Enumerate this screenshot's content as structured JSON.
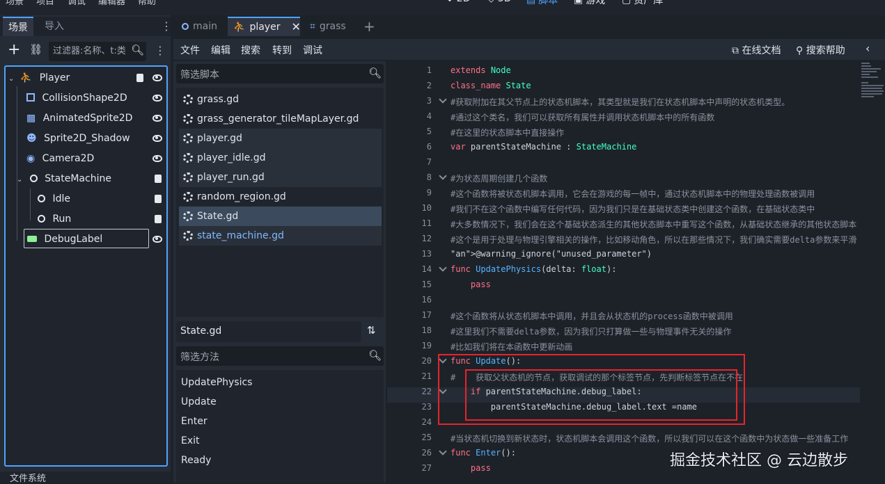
{
  "menubar": {
    "items": [
      "场景",
      "项目",
      "调试",
      "编辑器",
      "帮助"
    ],
    "workspaces": [
      {
        "label": "2D",
        "icon": "2d-icon"
      },
      {
        "label": "3D",
        "icon": "3d-icon"
      },
      {
        "label": "脚本",
        "icon": "script-icon",
        "active": true
      },
      {
        "label": "游戏",
        "icon": "game-icon"
      },
      {
        "label": "资产库",
        "icon": "assetlib-icon"
      }
    ]
  },
  "scene_dock": {
    "tabs": [
      "场景",
      "导入"
    ],
    "filter_placeholder": "过滤器:名称、t:类",
    "nodes": [
      {
        "name": "Player",
        "icon": "player-icon"
      },
      {
        "name": "CollisionShape2D",
        "icon": "collision-shape-icon"
      },
      {
        "name": "AnimatedSprite2D",
        "icon": "animated-sprite-icon"
      },
      {
        "name": "Sprite2D_Shadow",
        "icon": "sprite-icon"
      },
      {
        "name": "Camera2D",
        "icon": "camera-icon"
      },
      {
        "name": "StateMachine",
        "icon": "node-icon"
      },
      {
        "name": "Idle",
        "icon": "node-icon"
      },
      {
        "name": "Run",
        "icon": "node-icon"
      },
      {
        "name": "DebugLabel",
        "icon": "label-icon"
      }
    ],
    "bottom_tab": "文件系统"
  },
  "editor_tabs": [
    {
      "label": "main",
      "icon": "node-icon"
    },
    {
      "label": "player",
      "icon": "player-icon",
      "active": true
    },
    {
      "label": "grass",
      "icon": "grass-icon"
    }
  ],
  "script_menu": {
    "items": [
      "文件",
      "编辑",
      "搜索",
      "转到",
      "调试"
    ],
    "online_docs": "在线文档",
    "search_help": "搜索帮助"
  },
  "script_list": {
    "filter_placeholder": "筛选脚本",
    "items": [
      "grass.gd",
      "grass_generator_tileMapLayer.gd",
      "player.gd",
      "player_idle.gd",
      "player_run.gd",
      "random_region.gd",
      "State.gd",
      "state_machine.gd"
    ],
    "selected": "State.gd",
    "current_file": "State.gd"
  },
  "methods": {
    "filter_placeholder": "筛选方法",
    "items": [
      "UpdatePhysics",
      "Update",
      "Enter",
      "Exit",
      "Ready"
    ]
  },
  "code_lines": [
    "extends Node",
    "class_name State",
    "#获取附加在其父节点上的状态机脚本，其类型就是我们在状态机脚本中声明的状态机类型。",
    "#通过这个类名，我们可以获取所有属性并调用状态机脚本中的所有函数",
    "#在这里的状态脚本中直接操作",
    "var parentStateMachine : StateMachine",
    "",
    "#为状态周期创建几个函数",
    "#这个函数将被状态机脚本调用，它会在游戏的每一帧中，通过状态机脚本中的物理处理函数被调用",
    "#我们不在这个函数中编写任何代码，因为我们只是在基础状态类中创建这个函数，在基础状态类中",
    "#大多数情况下，我们会在这个基础状态派生的其他状态脚本中重写这个函数，从基础状态继承的其他状态脚本",
    "#这个是用于处理与物理引擎相关的操作，比如移动角色，所以在那些情况下，我们确实需要delta参数来平滑",
    "@warning_ignore(\"unused_parameter\")",
    "func UpdatePhysics(delta: float):",
    "    pass",
    "",
    "#这个函数将从状态机脚本中调用，并且会从状态机的process函数中被调用",
    "#这里我们不需要delta参数，因为我们只打算做一些与物理事件无关的操作",
    "#比如我们将在本函数中更新动画",
    "func Update():",
    "#    获取父状态机的节点，获取调试的那个标签节点，先判断标签节点在不在",
    "    if parentStateMachine.debug_label:",
    "        parentStateMachine.debug_label.text =name",
    "",
    "#当状态机切换到新状态时，状态机脚本会调用这个函数，所以我们可以在这个函数中为状态做一些准备工作",
    "func Enter():",
    "    pass"
  ],
  "watermark": "掘金技术社区 @ 云边散步",
  "colors": {
    "accent": "#4fa3ff",
    "highlight_box": "#e8242a",
    "keyword": "#ff7085",
    "type": "#42ffc2",
    "comment": "#8a919d"
  }
}
